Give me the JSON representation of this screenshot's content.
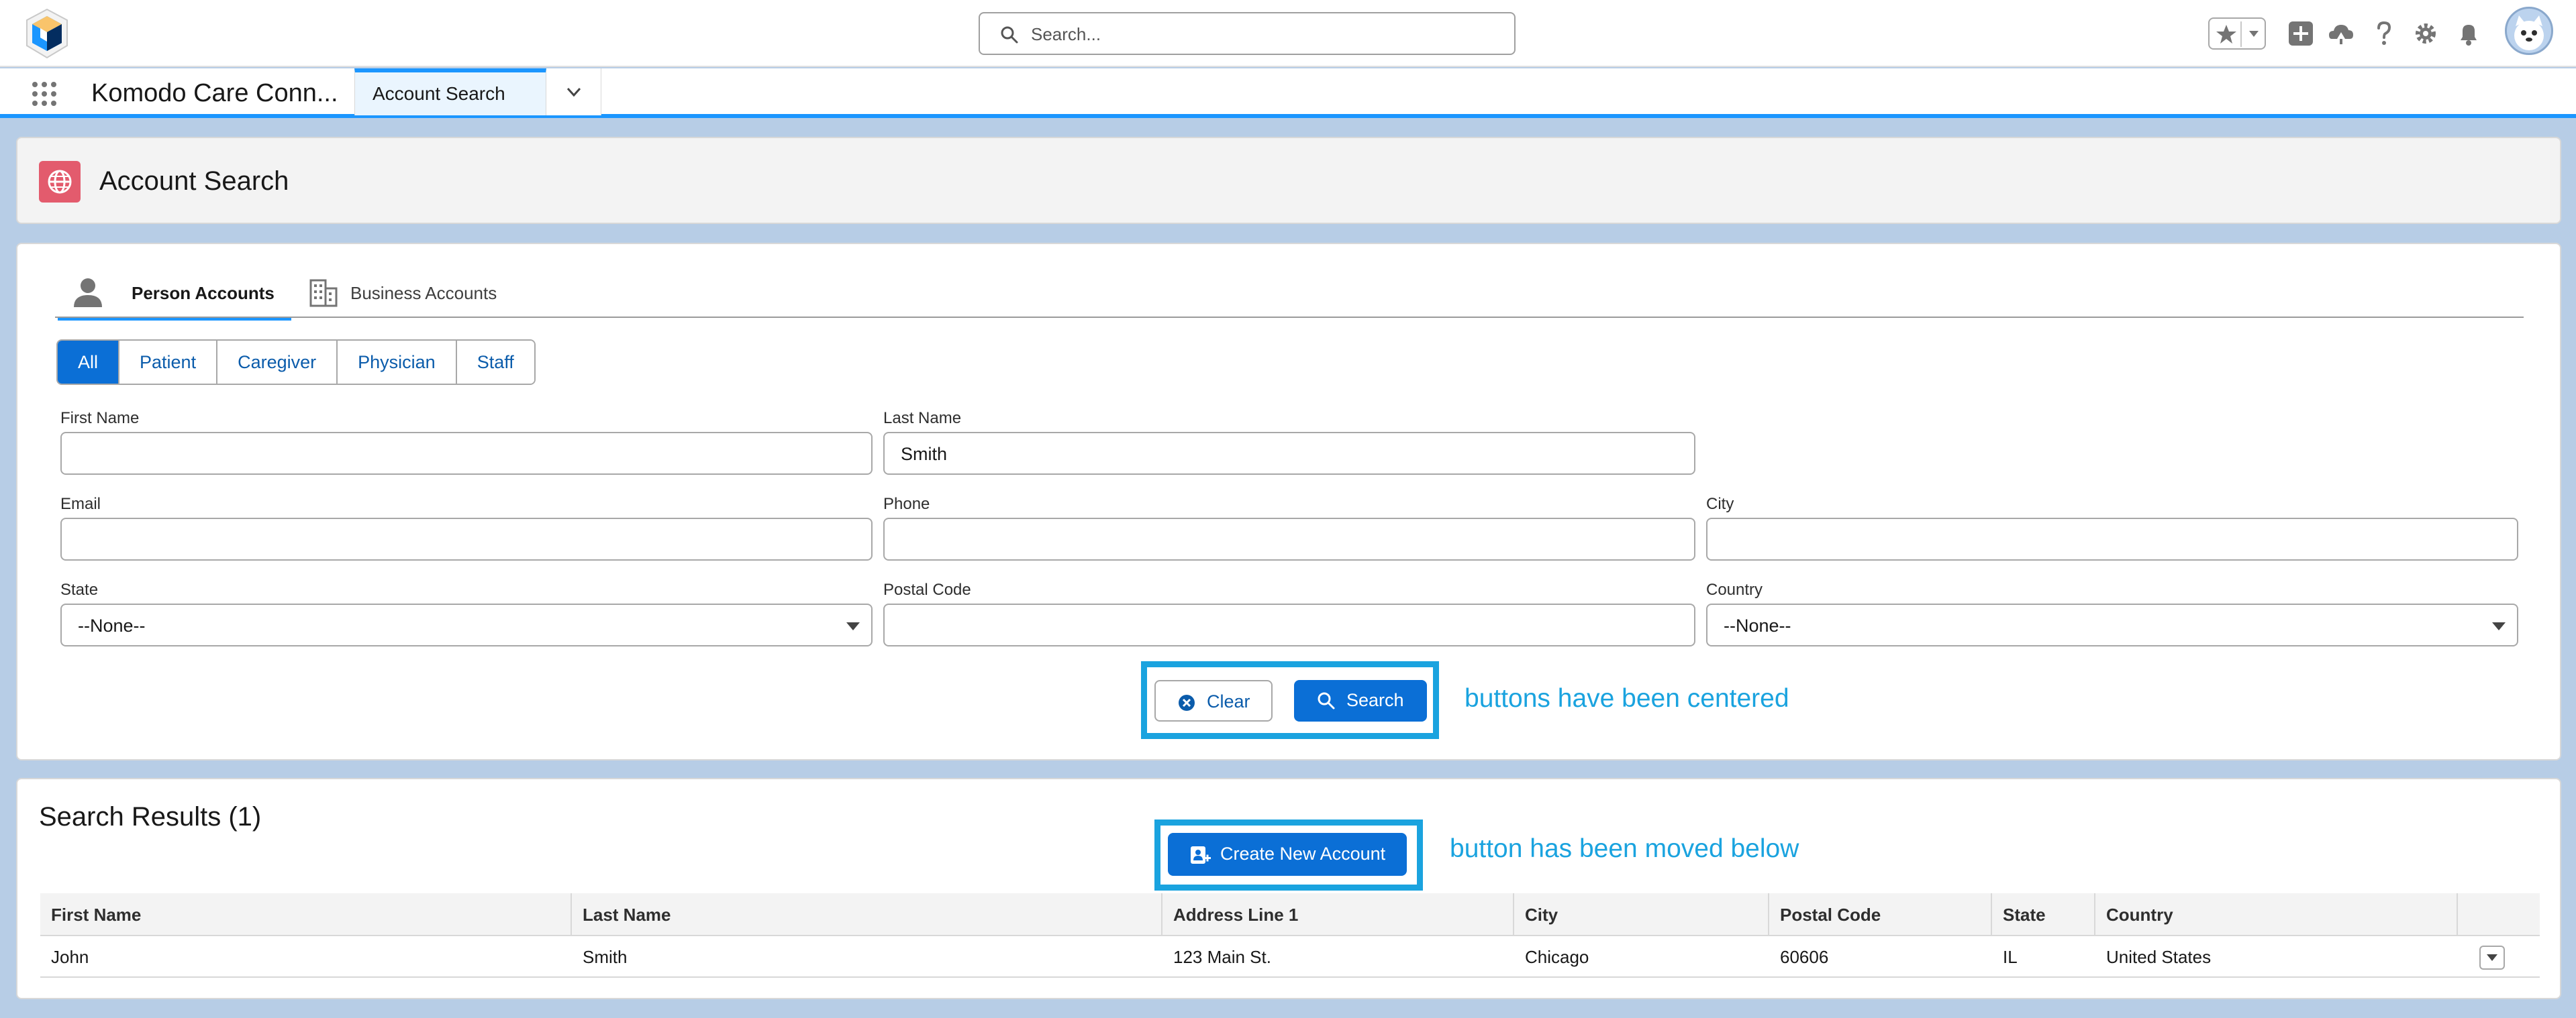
{
  "global_header": {
    "search_placeholder": "Search...",
    "icons": [
      "app-logo-icon",
      "favorites-star-icon",
      "favorites-dropdown-icon",
      "global-add-icon",
      "trailhead-icon",
      "help-icon",
      "setup-gear-icon",
      "notifications-bell-icon",
      "user-avatar"
    ]
  },
  "nav": {
    "app_name": "Komodo Care Conn...",
    "active_tab": "Account Search"
  },
  "page": {
    "title": "Account Search",
    "icon": "globe-icon",
    "accent_color": "#e35b6d"
  },
  "search_card": {
    "tabs": [
      {
        "label": "Person Accounts",
        "icon": "person-icon",
        "active": true
      },
      {
        "label": "Business Accounts",
        "icon": "building-icon",
        "active": false
      }
    ],
    "filter_buttons": [
      {
        "label": "All",
        "active": true
      },
      {
        "label": "Patient",
        "active": false
      },
      {
        "label": "Caregiver",
        "active": false
      },
      {
        "label": "Physician",
        "active": false
      },
      {
        "label": "Staff",
        "active": false
      }
    ],
    "fields": {
      "first_name": {
        "label": "First Name",
        "value": ""
      },
      "last_name": {
        "label": "Last Name",
        "value": "Smith"
      },
      "email": {
        "label": "Email",
        "value": ""
      },
      "phone": {
        "label": "Phone",
        "value": ""
      },
      "city": {
        "label": "City",
        "value": ""
      },
      "state": {
        "label": "State",
        "value": "--None--"
      },
      "postal_code": {
        "label": "Postal Code",
        "value": ""
      },
      "country": {
        "label": "Country",
        "value": "--None--"
      }
    },
    "clear_label": "Clear",
    "search_label": "Search",
    "annotation": "buttons have been centered"
  },
  "results": {
    "title": "Search Results (1)",
    "create_label": "Create New Account",
    "annotation": "button has been moved below",
    "columns": [
      "First Name",
      "Last Name",
      "Address Line 1",
      "City",
      "Postal Code",
      "State",
      "Country"
    ],
    "rows": [
      [
        "John",
        "Smith",
        "123 Main St.",
        "Chicago",
        "60606",
        "IL",
        "United States"
      ]
    ]
  },
  "colors": {
    "brand_blue": "#0b6fd6",
    "annotation_cyan": "#1aa3df",
    "tab_accent": "#1b96ff"
  }
}
